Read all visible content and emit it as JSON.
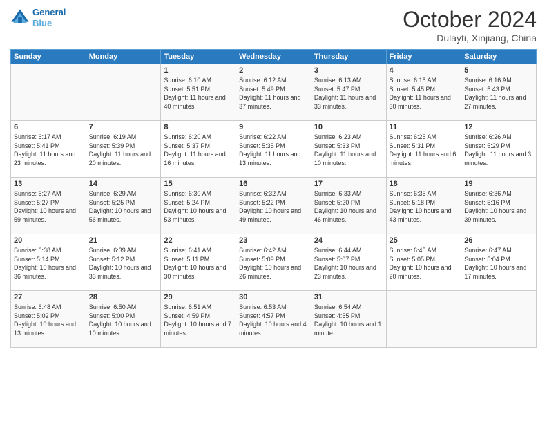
{
  "header": {
    "logo_line1": "General",
    "logo_line2": "Blue",
    "month": "October 2024",
    "location": "Dulayti, Xinjiang, China"
  },
  "days_of_week": [
    "Sunday",
    "Monday",
    "Tuesday",
    "Wednesday",
    "Thursday",
    "Friday",
    "Saturday"
  ],
  "weeks": [
    [
      {
        "day": "",
        "content": ""
      },
      {
        "day": "",
        "content": ""
      },
      {
        "day": "1",
        "sunrise": "Sunrise: 6:10 AM",
        "sunset": "Sunset: 5:51 PM",
        "daylight": "Daylight: 11 hours and 40 minutes."
      },
      {
        "day": "2",
        "sunrise": "Sunrise: 6:12 AM",
        "sunset": "Sunset: 5:49 PM",
        "daylight": "Daylight: 11 hours and 37 minutes."
      },
      {
        "day": "3",
        "sunrise": "Sunrise: 6:13 AM",
        "sunset": "Sunset: 5:47 PM",
        "daylight": "Daylight: 11 hours and 33 minutes."
      },
      {
        "day": "4",
        "sunrise": "Sunrise: 6:15 AM",
        "sunset": "Sunset: 5:45 PM",
        "daylight": "Daylight: 11 hours and 30 minutes."
      },
      {
        "day": "5",
        "sunrise": "Sunrise: 6:16 AM",
        "sunset": "Sunset: 5:43 PM",
        "daylight": "Daylight: 11 hours and 27 minutes."
      }
    ],
    [
      {
        "day": "6",
        "sunrise": "Sunrise: 6:17 AM",
        "sunset": "Sunset: 5:41 PM",
        "daylight": "Daylight: 11 hours and 23 minutes."
      },
      {
        "day": "7",
        "sunrise": "Sunrise: 6:19 AM",
        "sunset": "Sunset: 5:39 PM",
        "daylight": "Daylight: 11 hours and 20 minutes."
      },
      {
        "day": "8",
        "sunrise": "Sunrise: 6:20 AM",
        "sunset": "Sunset: 5:37 PM",
        "daylight": "Daylight: 11 hours and 16 minutes."
      },
      {
        "day": "9",
        "sunrise": "Sunrise: 6:22 AM",
        "sunset": "Sunset: 5:35 PM",
        "daylight": "Daylight: 11 hours and 13 minutes."
      },
      {
        "day": "10",
        "sunrise": "Sunrise: 6:23 AM",
        "sunset": "Sunset: 5:33 PM",
        "daylight": "Daylight: 11 hours and 10 minutes."
      },
      {
        "day": "11",
        "sunrise": "Sunrise: 6:25 AM",
        "sunset": "Sunset: 5:31 PM",
        "daylight": "Daylight: 11 hours and 6 minutes."
      },
      {
        "day": "12",
        "sunrise": "Sunrise: 6:26 AM",
        "sunset": "Sunset: 5:29 PM",
        "daylight": "Daylight: 11 hours and 3 minutes."
      }
    ],
    [
      {
        "day": "13",
        "sunrise": "Sunrise: 6:27 AM",
        "sunset": "Sunset: 5:27 PM",
        "daylight": "Daylight: 10 hours and 59 minutes."
      },
      {
        "day": "14",
        "sunrise": "Sunrise: 6:29 AM",
        "sunset": "Sunset: 5:25 PM",
        "daylight": "Daylight: 10 hours and 56 minutes."
      },
      {
        "day": "15",
        "sunrise": "Sunrise: 6:30 AM",
        "sunset": "Sunset: 5:24 PM",
        "daylight": "Daylight: 10 hours and 53 minutes."
      },
      {
        "day": "16",
        "sunrise": "Sunrise: 6:32 AM",
        "sunset": "Sunset: 5:22 PM",
        "daylight": "Daylight: 10 hours and 49 minutes."
      },
      {
        "day": "17",
        "sunrise": "Sunrise: 6:33 AM",
        "sunset": "Sunset: 5:20 PM",
        "daylight": "Daylight: 10 hours and 46 minutes."
      },
      {
        "day": "18",
        "sunrise": "Sunrise: 6:35 AM",
        "sunset": "Sunset: 5:18 PM",
        "daylight": "Daylight: 10 hours and 43 minutes."
      },
      {
        "day": "19",
        "sunrise": "Sunrise: 6:36 AM",
        "sunset": "Sunset: 5:16 PM",
        "daylight": "Daylight: 10 hours and 39 minutes."
      }
    ],
    [
      {
        "day": "20",
        "sunrise": "Sunrise: 6:38 AM",
        "sunset": "Sunset: 5:14 PM",
        "daylight": "Daylight: 10 hours and 36 minutes."
      },
      {
        "day": "21",
        "sunrise": "Sunrise: 6:39 AM",
        "sunset": "Sunset: 5:12 PM",
        "daylight": "Daylight: 10 hours and 33 minutes."
      },
      {
        "day": "22",
        "sunrise": "Sunrise: 6:41 AM",
        "sunset": "Sunset: 5:11 PM",
        "daylight": "Daylight: 10 hours and 30 minutes."
      },
      {
        "day": "23",
        "sunrise": "Sunrise: 6:42 AM",
        "sunset": "Sunset: 5:09 PM",
        "daylight": "Daylight: 10 hours and 26 minutes."
      },
      {
        "day": "24",
        "sunrise": "Sunrise: 6:44 AM",
        "sunset": "Sunset: 5:07 PM",
        "daylight": "Daylight: 10 hours and 23 minutes."
      },
      {
        "day": "25",
        "sunrise": "Sunrise: 6:45 AM",
        "sunset": "Sunset: 5:05 PM",
        "daylight": "Daylight: 10 hours and 20 minutes."
      },
      {
        "day": "26",
        "sunrise": "Sunrise: 6:47 AM",
        "sunset": "Sunset: 5:04 PM",
        "daylight": "Daylight: 10 hours and 17 minutes."
      }
    ],
    [
      {
        "day": "27",
        "sunrise": "Sunrise: 6:48 AM",
        "sunset": "Sunset: 5:02 PM",
        "daylight": "Daylight: 10 hours and 13 minutes."
      },
      {
        "day": "28",
        "sunrise": "Sunrise: 6:50 AM",
        "sunset": "Sunset: 5:00 PM",
        "daylight": "Daylight: 10 hours and 10 minutes."
      },
      {
        "day": "29",
        "sunrise": "Sunrise: 6:51 AM",
        "sunset": "Sunset: 4:59 PM",
        "daylight": "Daylight: 10 hours and 7 minutes."
      },
      {
        "day": "30",
        "sunrise": "Sunrise: 6:53 AM",
        "sunset": "Sunset: 4:57 PM",
        "daylight": "Daylight: 10 hours and 4 minutes."
      },
      {
        "day": "31",
        "sunrise": "Sunrise: 6:54 AM",
        "sunset": "Sunset: 4:55 PM",
        "daylight": "Daylight: 10 hours and 1 minute."
      },
      {
        "day": "",
        "content": ""
      },
      {
        "day": "",
        "content": ""
      }
    ]
  ]
}
